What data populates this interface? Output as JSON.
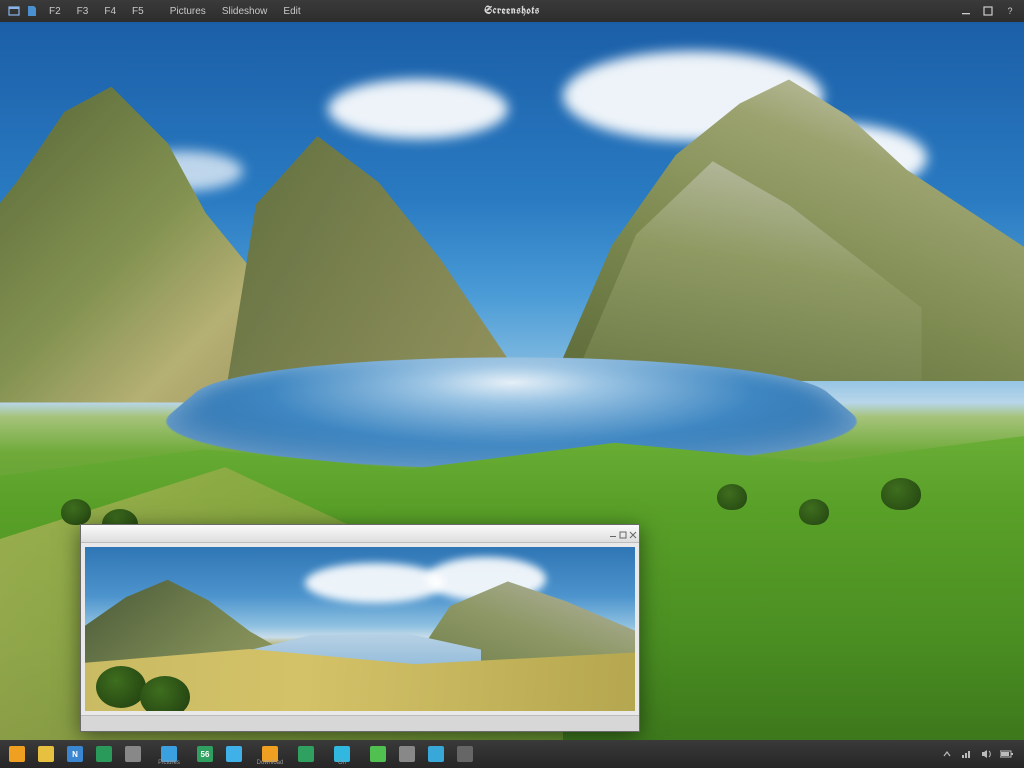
{
  "menubar": {
    "title": "Screenshots",
    "items": [
      "Pictures",
      "Slideshow",
      "Edit"
    ],
    "shortcuts": [
      "F2",
      "F3",
      "F4",
      "F5"
    ]
  },
  "popup": {
    "status_left": "",
    "status_right": ""
  },
  "taskbar": {
    "items": [
      {
        "name": "start",
        "label": "",
        "color": "#f0a020"
      },
      {
        "name": "explorer",
        "label": "",
        "color": "#e8c040"
      },
      {
        "name": "app1",
        "label": "",
        "color": "#3a86d0",
        "text": "N"
      },
      {
        "name": "app2",
        "label": "",
        "color": "#2a9a5a"
      },
      {
        "name": "browser",
        "label": "",
        "color": "#888"
      },
      {
        "name": "pictures",
        "label": "Pictures",
        "color": "#3aa0e0"
      },
      {
        "name": "app3",
        "label": "",
        "color": "#30a060",
        "text": "56"
      },
      {
        "name": "app4",
        "label": "",
        "color": "#40b0e8"
      },
      {
        "name": "download",
        "label": "Download",
        "color": "#f0a020"
      },
      {
        "name": "app5",
        "label": "",
        "color": "#30a060"
      },
      {
        "name": "settings",
        "label": "On",
        "color": "#30b8e0"
      },
      {
        "name": "chat",
        "label": "",
        "color": "#50c050"
      },
      {
        "name": "app6",
        "label": "",
        "color": "#888"
      },
      {
        "name": "app7",
        "label": "",
        "color": "#38a8d8"
      },
      {
        "name": "app8",
        "label": "",
        "color": "#666"
      }
    ]
  },
  "colors": {
    "panel": "#2d2d2d",
    "accent": "#3a86d0"
  }
}
